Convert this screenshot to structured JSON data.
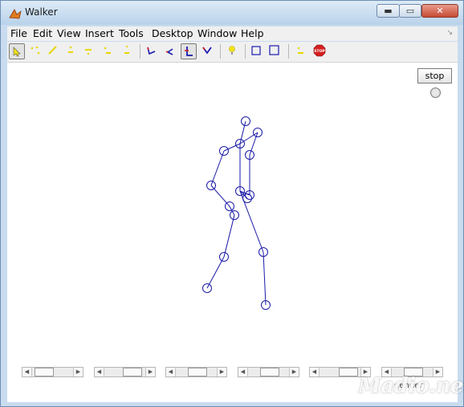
{
  "window": {
    "title": "Walker",
    "caption": {
      "minimize": "▬",
      "maximize": "▭",
      "close": "✕"
    }
  },
  "menu": [
    {
      "label": "File"
    },
    {
      "label": "Edit"
    },
    {
      "label": "View"
    },
    {
      "label": "Insert"
    },
    {
      "label": "Tools"
    },
    {
      "label": "Desktop"
    },
    {
      "label": "Window"
    },
    {
      "label": "Help"
    }
  ],
  "toolbar": {
    "icons": [
      "edit-plot-icon",
      "new-figure-icon",
      "open-file-icon",
      "save-icon",
      "print-icon",
      "figure-copy-icon",
      "figure-paste-icon",
      "rotate-x-icon",
      "rotate-y-icon",
      "rotate-z-icon",
      "view-v-icon",
      "light-icon",
      "box-icon",
      "box-alt-icon",
      "clear-icon",
      "stop-icon"
    ],
    "pressed": "rotate-z-icon"
  },
  "controls": {
    "stop_button": "stop",
    "gender_label": "gender",
    "sliders": [
      {
        "name": "slider-1",
        "value": 0.12
      },
      {
        "name": "slider-2",
        "value": 0.78
      },
      {
        "name": "slider-3",
        "value": 0.5
      },
      {
        "name": "slider-4",
        "value": 0.5
      },
      {
        "name": "slider-5",
        "value": 0.82
      },
      {
        "name": "slider-6",
        "value": 0.5
      }
    ]
  },
  "figure": {
    "line_color": "#1a1aa8",
    "marker": "circle"
  },
  "watermark": "Madio.net",
  "colors": {
    "accent": "#1a1aa8",
    "stop_icon": "#d42020"
  }
}
